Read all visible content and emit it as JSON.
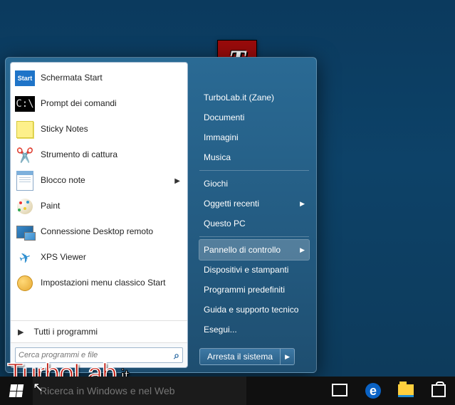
{
  "avatar": {
    "letter": "T"
  },
  "programs": [
    {
      "key": "start-screen",
      "label": "Schermata Start",
      "icon": "start",
      "submenu": false
    },
    {
      "key": "cmd",
      "label": "Prompt dei comandi",
      "icon": "cmd",
      "submenu": false
    },
    {
      "key": "sticky",
      "label": "Sticky Notes",
      "icon": "sticky",
      "submenu": false
    },
    {
      "key": "snip",
      "label": "Strumento di cattura",
      "icon": "snip",
      "submenu": false
    },
    {
      "key": "notepad",
      "label": "Blocco note",
      "icon": "note",
      "submenu": true
    },
    {
      "key": "paint",
      "label": "Paint",
      "icon": "paint",
      "submenu": false
    },
    {
      "key": "rdp",
      "label": "Connessione Desktop remoto",
      "icon": "rdp",
      "submenu": false
    },
    {
      "key": "xps",
      "label": "XPS Viewer",
      "icon": "xps",
      "submenu": false
    },
    {
      "key": "classic",
      "label": "Impostazioni menu classico Start",
      "icon": "shell",
      "submenu": false
    }
  ],
  "all_programs": "Tutti i programmi",
  "search": {
    "placeholder": "Cerca programmi e file"
  },
  "right": {
    "user": "TurboLab.it (Zane)",
    "links1": [
      {
        "key": "docs",
        "label": "Documenti",
        "submenu": false
      },
      {
        "key": "imgs",
        "label": "Immagini",
        "submenu": false
      },
      {
        "key": "music",
        "label": "Musica",
        "submenu": false
      }
    ],
    "links2": [
      {
        "key": "games",
        "label": "Giochi",
        "submenu": false
      },
      {
        "key": "recent",
        "label": "Oggetti recenti",
        "submenu": true
      },
      {
        "key": "thispc",
        "label": "Questo PC",
        "submenu": false
      }
    ],
    "links3": [
      {
        "key": "control",
        "label": "Pannello di controllo",
        "submenu": true,
        "selected": true
      },
      {
        "key": "devices",
        "label": "Dispositivi e stampanti",
        "submenu": false
      },
      {
        "key": "defaults",
        "label": "Programmi predefiniti",
        "submenu": false
      },
      {
        "key": "help",
        "label": "Guida e supporto tecnico",
        "submenu": false
      },
      {
        "key": "run",
        "label": "Esegui...",
        "submenu": false
      }
    ],
    "shutdown": "Arresta il sistema"
  },
  "taskbar": {
    "cortana_placeholder": "Ricerca in Windows e nel Web"
  },
  "watermark": {
    "main": "TurboLab",
    "suffix": ".it"
  }
}
